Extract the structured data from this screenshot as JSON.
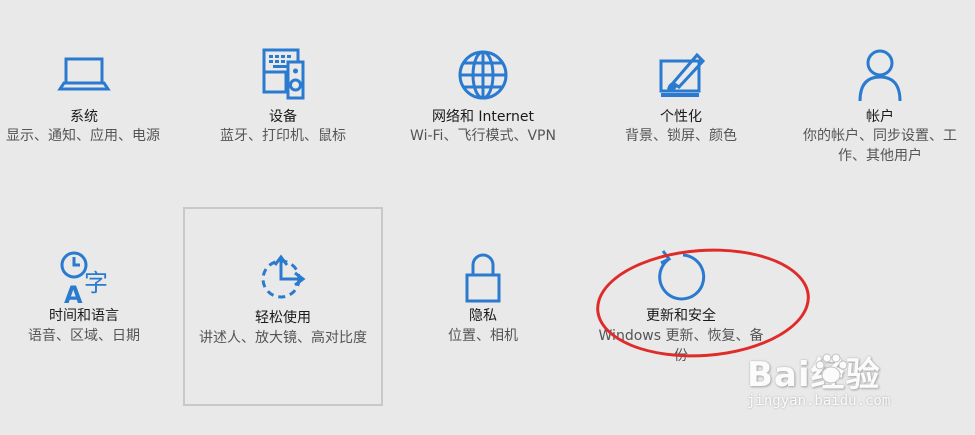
{
  "tiles": [
    {
      "id": "system",
      "title": "系统",
      "desc": "显示、通知、应用、电源",
      "icon": "laptop-icon"
    },
    {
      "id": "devices",
      "title": "设备",
      "desc": "蓝牙、打印机、鼠标",
      "icon": "devices-icon"
    },
    {
      "id": "network",
      "title": "网络和 Internet",
      "desc": "Wi-Fi、飞行模式、VPN",
      "icon": "globe-icon"
    },
    {
      "id": "personal",
      "title": "个性化",
      "desc": "背景、锁屏、颜色",
      "icon": "paint-icon"
    },
    {
      "id": "accounts",
      "title": "帐户",
      "desc": "你的帐户、同步设置、工作、其他用户",
      "icon": "person-icon"
    },
    {
      "id": "time",
      "title": "时间和语言",
      "desc": "语音、区域、日期",
      "icon": "time-language-icon"
    },
    {
      "id": "ease",
      "title": "轻松使用",
      "desc": "讲述人、放大镜、高对比度",
      "icon": "ease-of-access-icon"
    },
    {
      "id": "privacy",
      "title": "隐私",
      "desc": "位置、相机",
      "icon": "lock-icon"
    },
    {
      "id": "update",
      "title": "更新和安全",
      "desc": "Windows 更新、恢复、备份",
      "icon": "refresh-icon"
    }
  ],
  "colors": {
    "accent": "#2a7bd0",
    "annotation": "#e02b2b",
    "background": "#e9e9e9"
  },
  "watermark": {
    "logo": "Bai经验",
    "url": "jingyan.baidu.com"
  }
}
